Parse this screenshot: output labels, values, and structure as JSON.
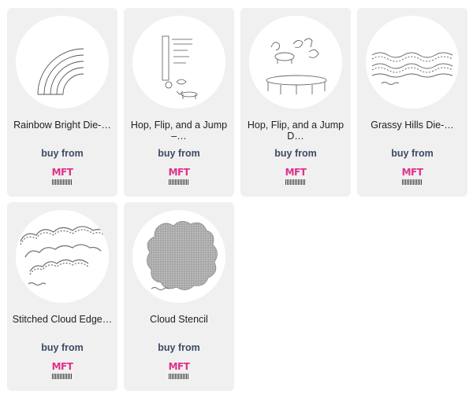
{
  "products": [
    {
      "title": "Rainbow Bright Die-…",
      "buy_label": "buy from",
      "store_logo": "MFT",
      "image": "rainbow-die"
    },
    {
      "title": "Hop, Flip, and a Jump –…",
      "buy_label": "buy from",
      "store_logo": "MFT",
      "image": "stamp-sheet"
    },
    {
      "title": "Hop, Flip, and a Jump D…",
      "buy_label": "buy from",
      "store_logo": "MFT",
      "image": "trampoline-die"
    },
    {
      "title": "Grassy Hills Die-…",
      "buy_label": "buy from",
      "store_logo": "MFT",
      "image": "grassy-hills-die"
    },
    {
      "title": "Stitched Cloud Edge…",
      "buy_label": "buy from",
      "store_logo": "MFT",
      "image": "cloud-edge-die"
    },
    {
      "title": "Cloud Stencil",
      "buy_label": "buy from",
      "store_logo": "MFT",
      "image": "cloud-stencil"
    }
  ],
  "colors": {
    "card_bg": "#f0f0f0",
    "buy_text": "#3d4a66",
    "logo_pink": "#e0308a"
  }
}
